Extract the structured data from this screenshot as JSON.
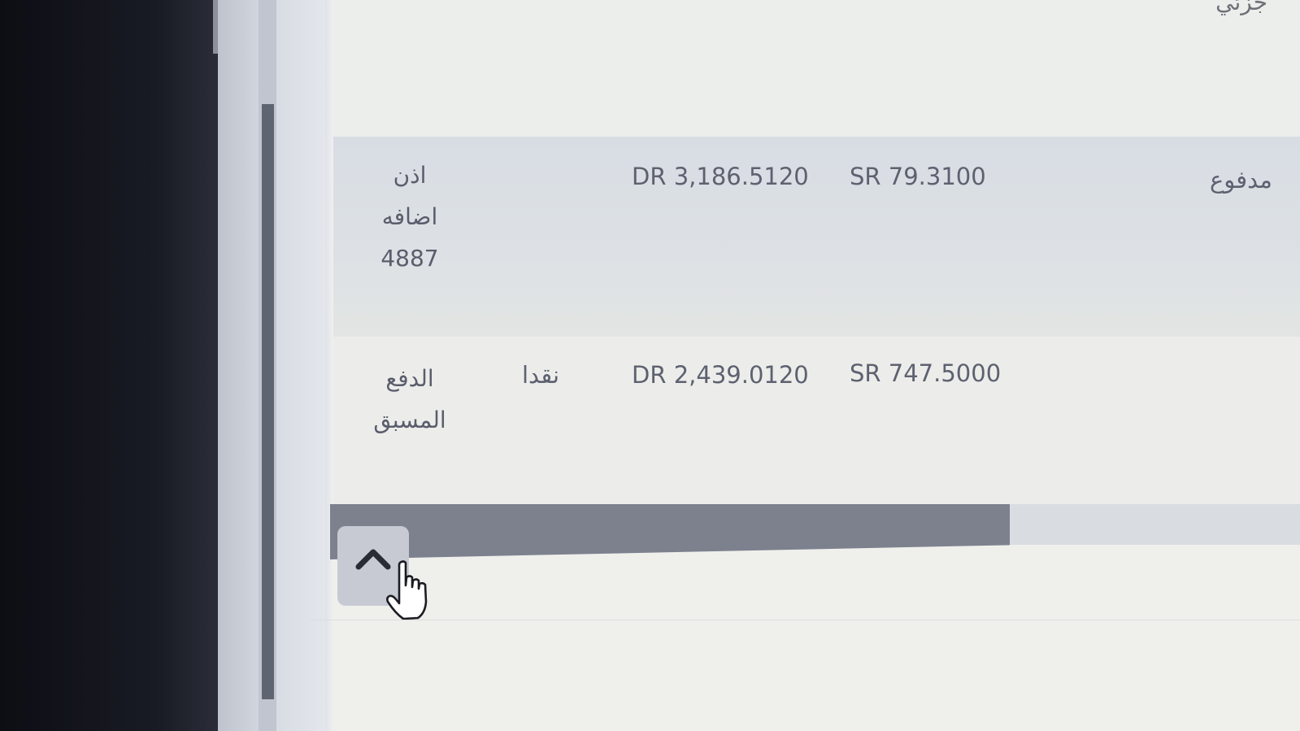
{
  "header": {
    "clipped_text": "جزئي"
  },
  "table": {
    "rows": [
      {
        "type": "اذن اضافه 4887",
        "method": "",
        "dr": "DR 3,186.5120",
        "sr": "SR 79.3100",
        "status": "مدفوع"
      },
      {
        "type": "الدفع المسبق",
        "method": "نقدا",
        "dr": "DR 2,439.0120",
        "sr": "SR 747.5000",
        "status": ""
      }
    ]
  },
  "icons": {
    "scroll_top": "chevron-up-icon",
    "cursor": "hand-cursor-icon"
  },
  "colors": {
    "row_highlight": "#d8dde4",
    "text": "#5d6170",
    "scroll_thumb": "#7d818e"
  }
}
